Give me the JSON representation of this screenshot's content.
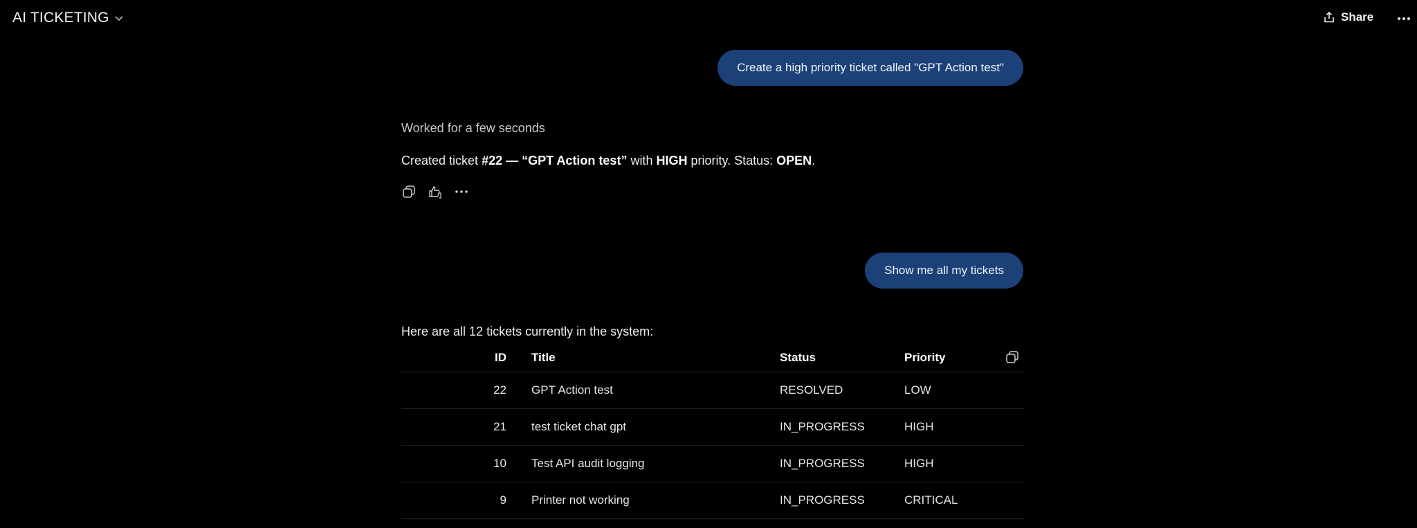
{
  "header": {
    "app_title": "AI TICKETING",
    "share_label": "Share"
  },
  "conversation": {
    "user_message_1": "Create a high priority ticket called \"GPT Action test\"",
    "worked_status": "Worked for a few seconds",
    "reply_1": {
      "prefix": "Created ticket ",
      "ticket_ref": "#22 — “GPT Action test”",
      "mid": " with ",
      "priority": "HIGH",
      "mid2": " priority. Status: ",
      "status": "OPEN",
      "suffix": "."
    },
    "user_message_2": "Show me all my tickets",
    "tickets_intro": "Here are all 12 tickets currently in the system:"
  },
  "table": {
    "columns": [
      "ID",
      "Title",
      "Status",
      "Priority"
    ],
    "rows": [
      {
        "id": "22",
        "title": "GPT Action test",
        "status": "RESOLVED",
        "priority": "LOW"
      },
      {
        "id": "21",
        "title": "test ticket chat gpt",
        "status": "IN_PROGRESS",
        "priority": "HIGH"
      },
      {
        "id": "10",
        "title": "Test API audit logging",
        "status": "IN_PROGRESS",
        "priority": "HIGH"
      },
      {
        "id": "9",
        "title": "Printer not working",
        "status": "IN_PROGRESS",
        "priority": "CRITICAL"
      }
    ]
  },
  "icons": {
    "title_dropdown": "chevron-down-icon",
    "share": "share-icon",
    "more": "more-horizontal-icon",
    "copy": "copy-icon",
    "feedback": "thumbs-feedback-icon",
    "table_copy": "copy-icon"
  },
  "colors": {
    "background": "#000000",
    "user_bubble": "#1b4178",
    "text": "#ececec"
  }
}
